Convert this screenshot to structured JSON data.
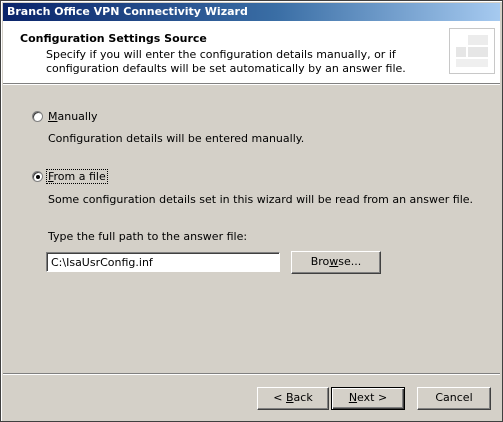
{
  "window": {
    "title": "Branch Office VPN Connectivity Wizard"
  },
  "header": {
    "title": "Configuration Settings Source",
    "subtitle": "Specify if you will enter the configuration details manually, or if configuration defaults will be set automatically by an answer file."
  },
  "options": {
    "manual": {
      "label_access_key": "M",
      "label_rest": "anually",
      "description": "Configuration details will be entered manually.",
      "selected": false
    },
    "file": {
      "label_access_key": "F",
      "label_rest": "rom a file",
      "description": "Some configuration details set in this wizard will be read from an answer file.",
      "selected": true
    }
  },
  "path": {
    "label": "Type the full path to the answer file:",
    "value": "C:\\IsaUsrConfig.inf"
  },
  "buttons": {
    "browse_prefix": "Bro",
    "browse_key": "w",
    "browse_suffix": "se...",
    "back_prefix": "< ",
    "back_key": "B",
    "back_suffix": "ack",
    "next_key": "N",
    "next_suffix": "ext >",
    "cancel": "Cancel"
  }
}
